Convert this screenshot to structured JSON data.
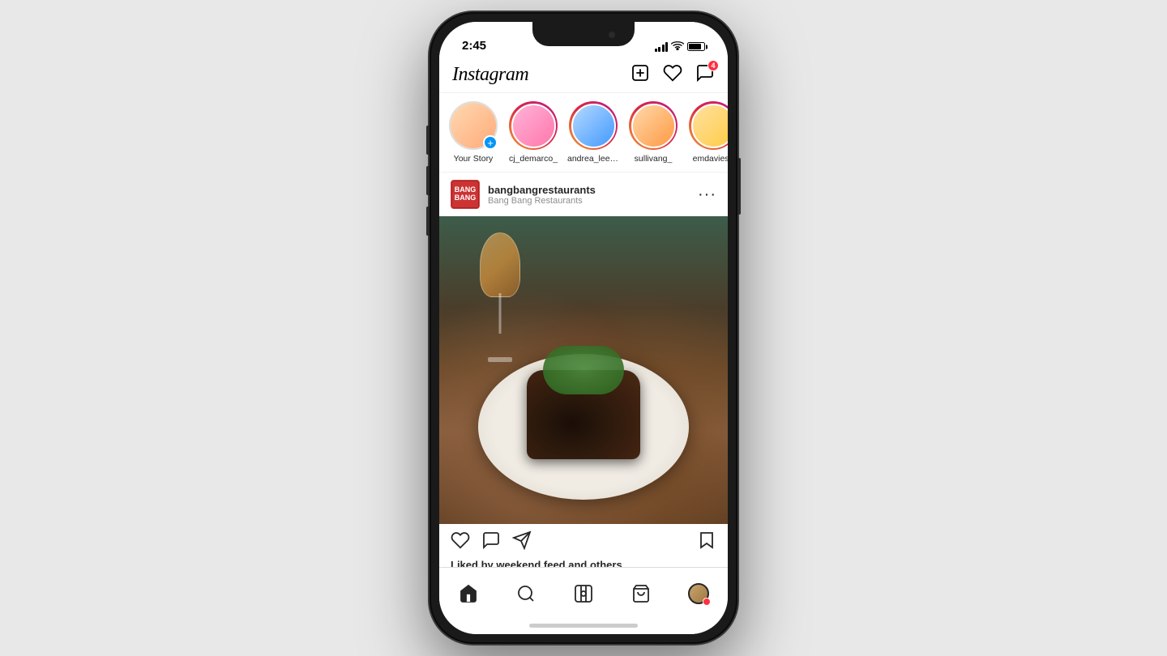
{
  "phone": {
    "status_bar": {
      "time": "2:45",
      "battery_percent": 85
    },
    "header": {
      "logo": "Instagram",
      "add_icon": "plus-square-icon",
      "heart_icon": "heart-icon",
      "messages_icon": "messenger-icon",
      "notification_count": "4"
    },
    "stories": [
      {
        "id": "your-story",
        "username": "Your Story",
        "has_ring": false,
        "avatar_color": "av-peach"
      },
      {
        "id": "cj-demarco",
        "username": "cj_demarco_",
        "has_ring": true,
        "avatar_color": "av-pink"
      },
      {
        "id": "andrea-leema",
        "username": "andrea_leema",
        "has_ring": true,
        "avatar_color": "av-blue"
      },
      {
        "id": "sullivang",
        "username": "sullivang_",
        "has_ring": true,
        "avatar_color": "av-orange"
      },
      {
        "id": "emdavies",
        "username": "emdavies_",
        "has_ring": true,
        "avatar_color": "av-blonde"
      }
    ],
    "post": {
      "username": "bangbangrestaurants",
      "subname": "Bang Bang Restaurants",
      "avatar_text": "BANG\nBANG",
      "more_button": "•••",
      "likes_text": "Liked by",
      "likes_bold": "weekend.feed",
      "likes_suffix": " and others"
    },
    "bottom_nav": [
      {
        "id": "home",
        "label": "Home",
        "active": true
      },
      {
        "id": "search",
        "label": "Search",
        "active": false
      },
      {
        "id": "reels",
        "label": "Reels",
        "active": false
      },
      {
        "id": "shop",
        "label": "Shop",
        "active": false
      },
      {
        "id": "profile",
        "label": "Profile",
        "active": false
      }
    ]
  }
}
